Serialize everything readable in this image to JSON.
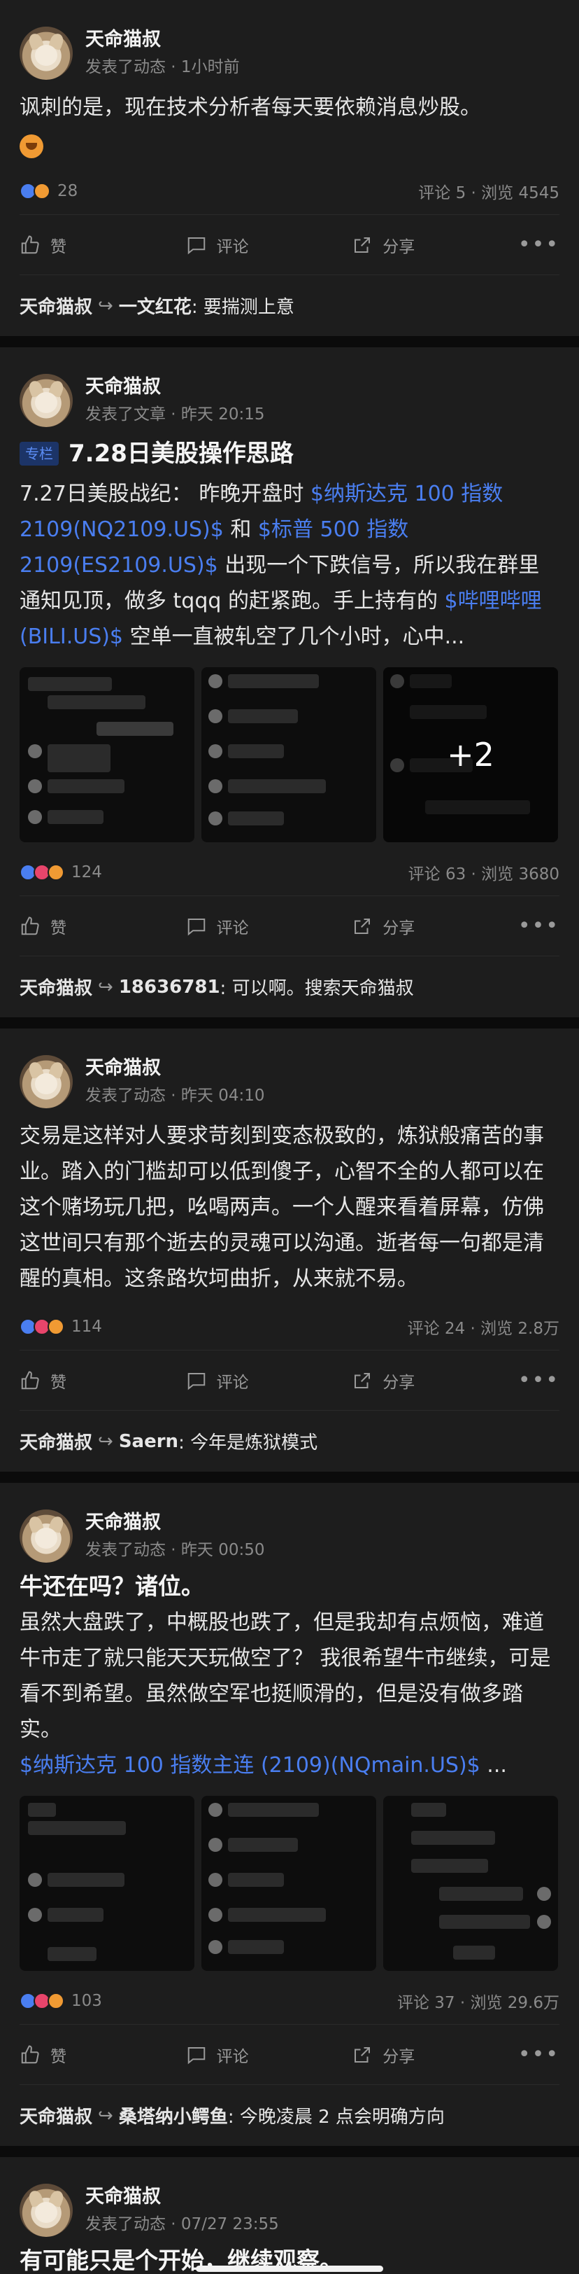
{
  "labels": {
    "like": "赞",
    "comment": "评论",
    "share": "分享",
    "more": "•••",
    "arrow": "↪"
  },
  "posts": [
    {
      "author": "天命猫叔",
      "sub": "发表了动态 · 1小时前",
      "text": "讽刺的是，现在技术分析者每天要依赖消息炒股。",
      "reaction_count": "28",
      "stats_right": "评论 5 · 浏览 4545",
      "reply": {
        "author": "天命猫叔",
        "target": "一文红花",
        "text": ": 要揣测上意"
      }
    },
    {
      "author": "天命猫叔",
      "sub": "发表了文章 · 昨天 20:15",
      "tag": "专栏",
      "title": "7.28日美股操作思路",
      "text_parts": [
        "7.27日美股战纪：  昨晚开盘时 ",
        "$纳斯达克 100 指数 2109(NQ2109.US)$",
        " 和 ",
        "$标普 500 指数 2109(ES2109.US)$",
        " 出现一个下跌信号，所以我在群里通知见顶，做多 tqqq 的赶紧跑。手上持有的 ",
        "$哔哩哔哩 (BILI.US)$",
        " 空单一直被轧空了几个小时，心中..."
      ],
      "more_images": "+2",
      "reaction_count": "124",
      "stats_right": "评论 63 · 浏览 3680",
      "reply": {
        "author": "天命猫叔",
        "target": "18636781",
        "text": ": 可以啊。搜索天命猫叔"
      }
    },
    {
      "author": "天命猫叔",
      "sub": "发表了动态 · 昨天 04:10",
      "text": "交易是这样对人要求苛刻到变态极致的，炼狱般痛苦的事业。踏入的门槛却可以低到傻子，心智不全的人都可以在这个赌场玩几把，吆喝两声。一个人醒来看着屏幕，仿佛这世间只有那个逝去的灵魂可以沟通。逝者每一句都是清醒的真相。这条路坎坷曲折，从来就不易。",
      "reaction_count": "114",
      "stats_right": "评论 24 · 浏览 2.8万",
      "reply": {
        "author": "天命猫叔",
        "target": "Saern",
        "text": ": 今年是炼狱模式"
      }
    },
    {
      "author": "天命猫叔",
      "sub": "发表了动态 · 昨天 00:50",
      "headline": "牛还在吗？诸位。",
      "text": "虽然大盘跌了，中概股也跌了，但是我却有点烦恼，难道牛市走了就只能天天玩做空了？ 我很希望牛市继续，可是看不到希望。虽然做空军也挺顺滑的，但是没有做多踏实。",
      "link": "$纳斯达克 100 指数主连 (2109)(NQmain.US)$",
      "link_suffix": " ...",
      "reaction_count": "103",
      "stats_right": "评论 37 · 浏览 29.6万",
      "reply": {
        "author": "天命猫叔",
        "target": "桑塔纳小鳄鱼",
        "text": ": 今晚凌晨 2 点会明确方向"
      }
    },
    {
      "author": "天命猫叔",
      "sub": "发表了动态 · 07/27 23:55",
      "headline": "有可能只是个开始，继续观察。"
    }
  ]
}
